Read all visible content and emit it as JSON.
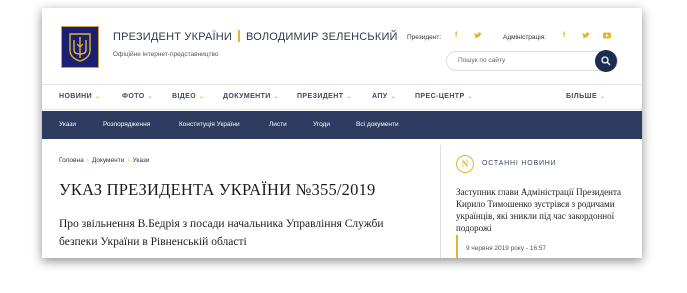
{
  "header": {
    "title_left": "ПРЕЗИДЕНТ УКРАЇНИ",
    "title_right": "ВОЛОДИМИР ЗЕЛЕНСЬКИЙ",
    "subtitle": "Офіційне інтернет-представництво",
    "president_label": "Президент:",
    "administration_label": "Адміністрація:"
  },
  "search": {
    "placeholder": "Пошук по сайту"
  },
  "main_nav": {
    "items": [
      {
        "label": "НОВИНИ"
      },
      {
        "label": "ФОТО"
      },
      {
        "label": "ВІДЕО"
      },
      {
        "label": "ДОКУМЕНТИ"
      },
      {
        "label": "ПРЕЗИДЕНТ"
      },
      {
        "label": "АПУ"
      },
      {
        "label": "ПРЕС-ЦЕНТР"
      },
      {
        "label": "БІЛЬШЕ"
      }
    ]
  },
  "sub_nav": {
    "items": [
      {
        "label": "Укази"
      },
      {
        "label": "Розпорядження"
      },
      {
        "label": "Конституція України"
      },
      {
        "label": "Листи"
      },
      {
        "label": "Угоди"
      },
      {
        "label": "Всі документи"
      }
    ]
  },
  "breadcrumb": [
    "Головна",
    "Документи",
    "Укази"
  ],
  "document": {
    "title": "УКАЗ ПРЕЗИДЕНТА УКРАЇНИ №355/2019",
    "lead": "Про звільнення В.Бедрія з посади начальника Управління Служби безпеки України в Рівненській області"
  },
  "latest_news": {
    "icon_letter": "N",
    "heading": "ОСТАННІ НОВИНИ",
    "item_title": "Заступник глави Адміністрації Президента Кирило Тимошенко зустрівся з родичами українців, які зникли під час закордонної подорожі",
    "item_date": "9 червня 2019 року - 16:57"
  },
  "colors": {
    "accent": "#e0b530",
    "nav_dark": "#2c3b5f",
    "button_dark": "#1d2c52"
  }
}
